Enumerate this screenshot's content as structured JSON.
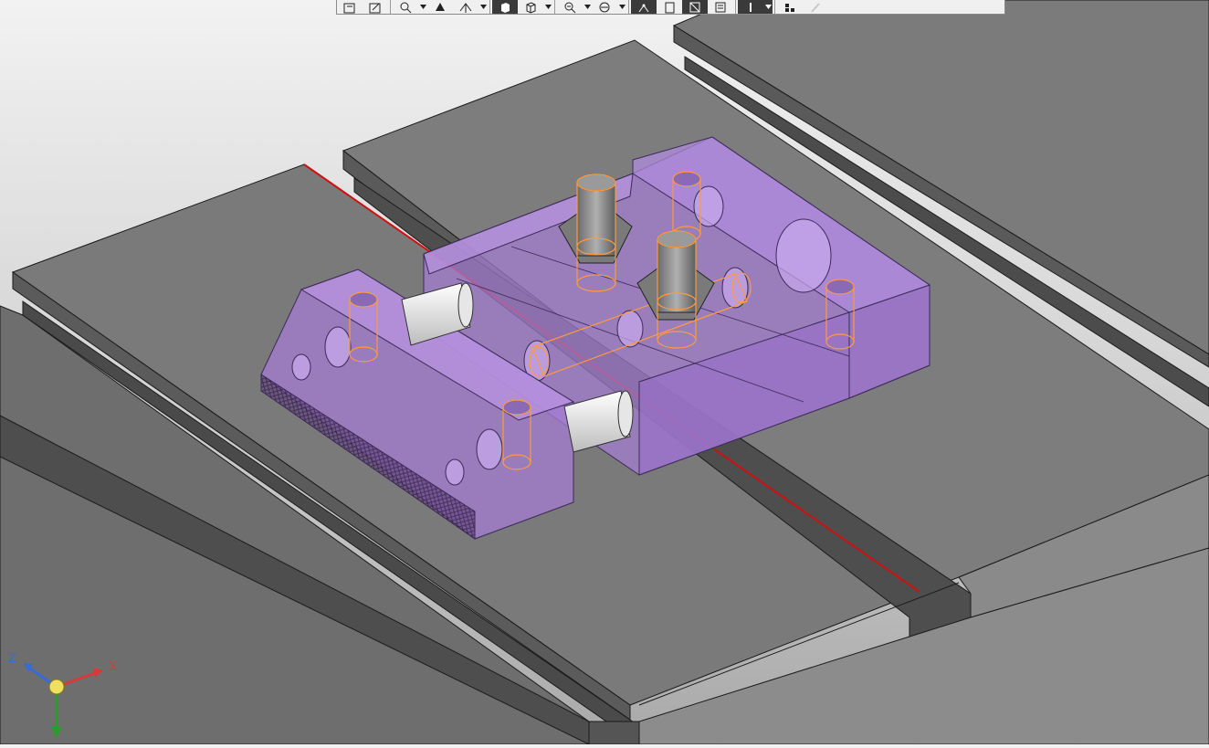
{
  "window": {
    "title": ""
  },
  "toolbar": {
    "buttons": [
      {
        "name": "new-sketch",
        "icon": "sketch-icon",
        "active": false
      },
      {
        "name": "edit-sketch",
        "icon": "edit-sketch-icon",
        "active": false
      },
      {
        "name": "zoom",
        "icon": "zoom-icon",
        "active": false,
        "dropdown": true
      },
      {
        "name": "rotate",
        "icon": "rotate-icon",
        "active": false
      },
      {
        "name": "orientation",
        "icon": "orientation-icon",
        "active": false,
        "dropdown": true
      },
      {
        "name": "shaded",
        "icon": "shaded-cube-icon",
        "active": true
      },
      {
        "name": "wireframe",
        "icon": "wireframe-cube-icon",
        "active": false,
        "dropdown": true
      },
      {
        "name": "zoom-window",
        "icon": "zoom-window-icon",
        "active": false,
        "dropdown": true
      },
      {
        "name": "section",
        "icon": "section-icon",
        "active": false,
        "dropdown": true
      },
      {
        "name": "snap",
        "icon": "snap-icon",
        "active": true
      },
      {
        "name": "layer",
        "icon": "layer-icon",
        "active": false
      },
      {
        "name": "filter",
        "icon": "filter-icon",
        "active": true
      },
      {
        "name": "properties",
        "icon": "properties-icon",
        "active": false
      },
      {
        "name": "select",
        "icon": "select-icon",
        "active": true,
        "dropdown": true
      },
      {
        "name": "tree",
        "icon": "tree-icon",
        "active": false
      },
      {
        "name": "pen",
        "icon": "pen-icon",
        "active": false
      }
    ]
  },
  "scene": {
    "colors": {
      "table_top": "#7a7a7a",
      "table_side": "#5a5a5a",
      "table_light": "#8e8e8e",
      "part_fill": "#a77fd6",
      "part_edge": "#3c2a57",
      "highlight": "#ff9a3c",
      "section_line": "#d01010",
      "bolt": "#8c8c8c",
      "pin": "#f2f2f2"
    }
  },
  "triad": {
    "x_label": "X",
    "z_label": "Z",
    "colors": {
      "x": "#d63a3a",
      "y": "#2e9a2e",
      "z": "#3a6ad6",
      "origin": "#f0e060"
    }
  }
}
